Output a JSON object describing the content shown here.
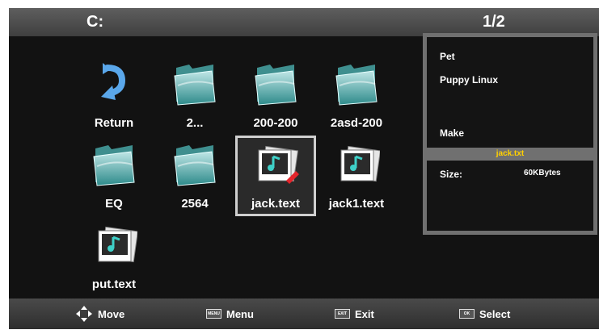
{
  "header": {
    "drive": "C:",
    "page": "1/2"
  },
  "items": [
    {
      "label": "Return",
      "type": "return"
    },
    {
      "label": "2...",
      "type": "folder"
    },
    {
      "label": "200-200",
      "type": "folder"
    },
    {
      "label": "2asd-200",
      "type": "folder"
    },
    {
      "label": "EQ",
      "type": "folder"
    },
    {
      "label": "2564",
      "type": "folder"
    },
    {
      "label": "jack.text",
      "type": "music",
      "selected": true
    },
    {
      "label": "jack1.text",
      "type": "music"
    },
    {
      "label": "put.text",
      "type": "music"
    }
  ],
  "info": {
    "line1": "Pet",
    "line2": "Puppy Linux",
    "line3": "Make",
    "filename": "jack.txt",
    "size_label": "Size:",
    "size_value": "60KBytes"
  },
  "footer": {
    "move": "Move",
    "menu": "Menu",
    "menu_key": "MENU",
    "exit": "Exit",
    "exit_key": "EXIT",
    "select": "Select",
    "select_key": "OK"
  },
  "colors": {
    "background": "#121212",
    "bar": "#4a4a4a",
    "frame": "#707070",
    "accent": "#ffd000"
  }
}
